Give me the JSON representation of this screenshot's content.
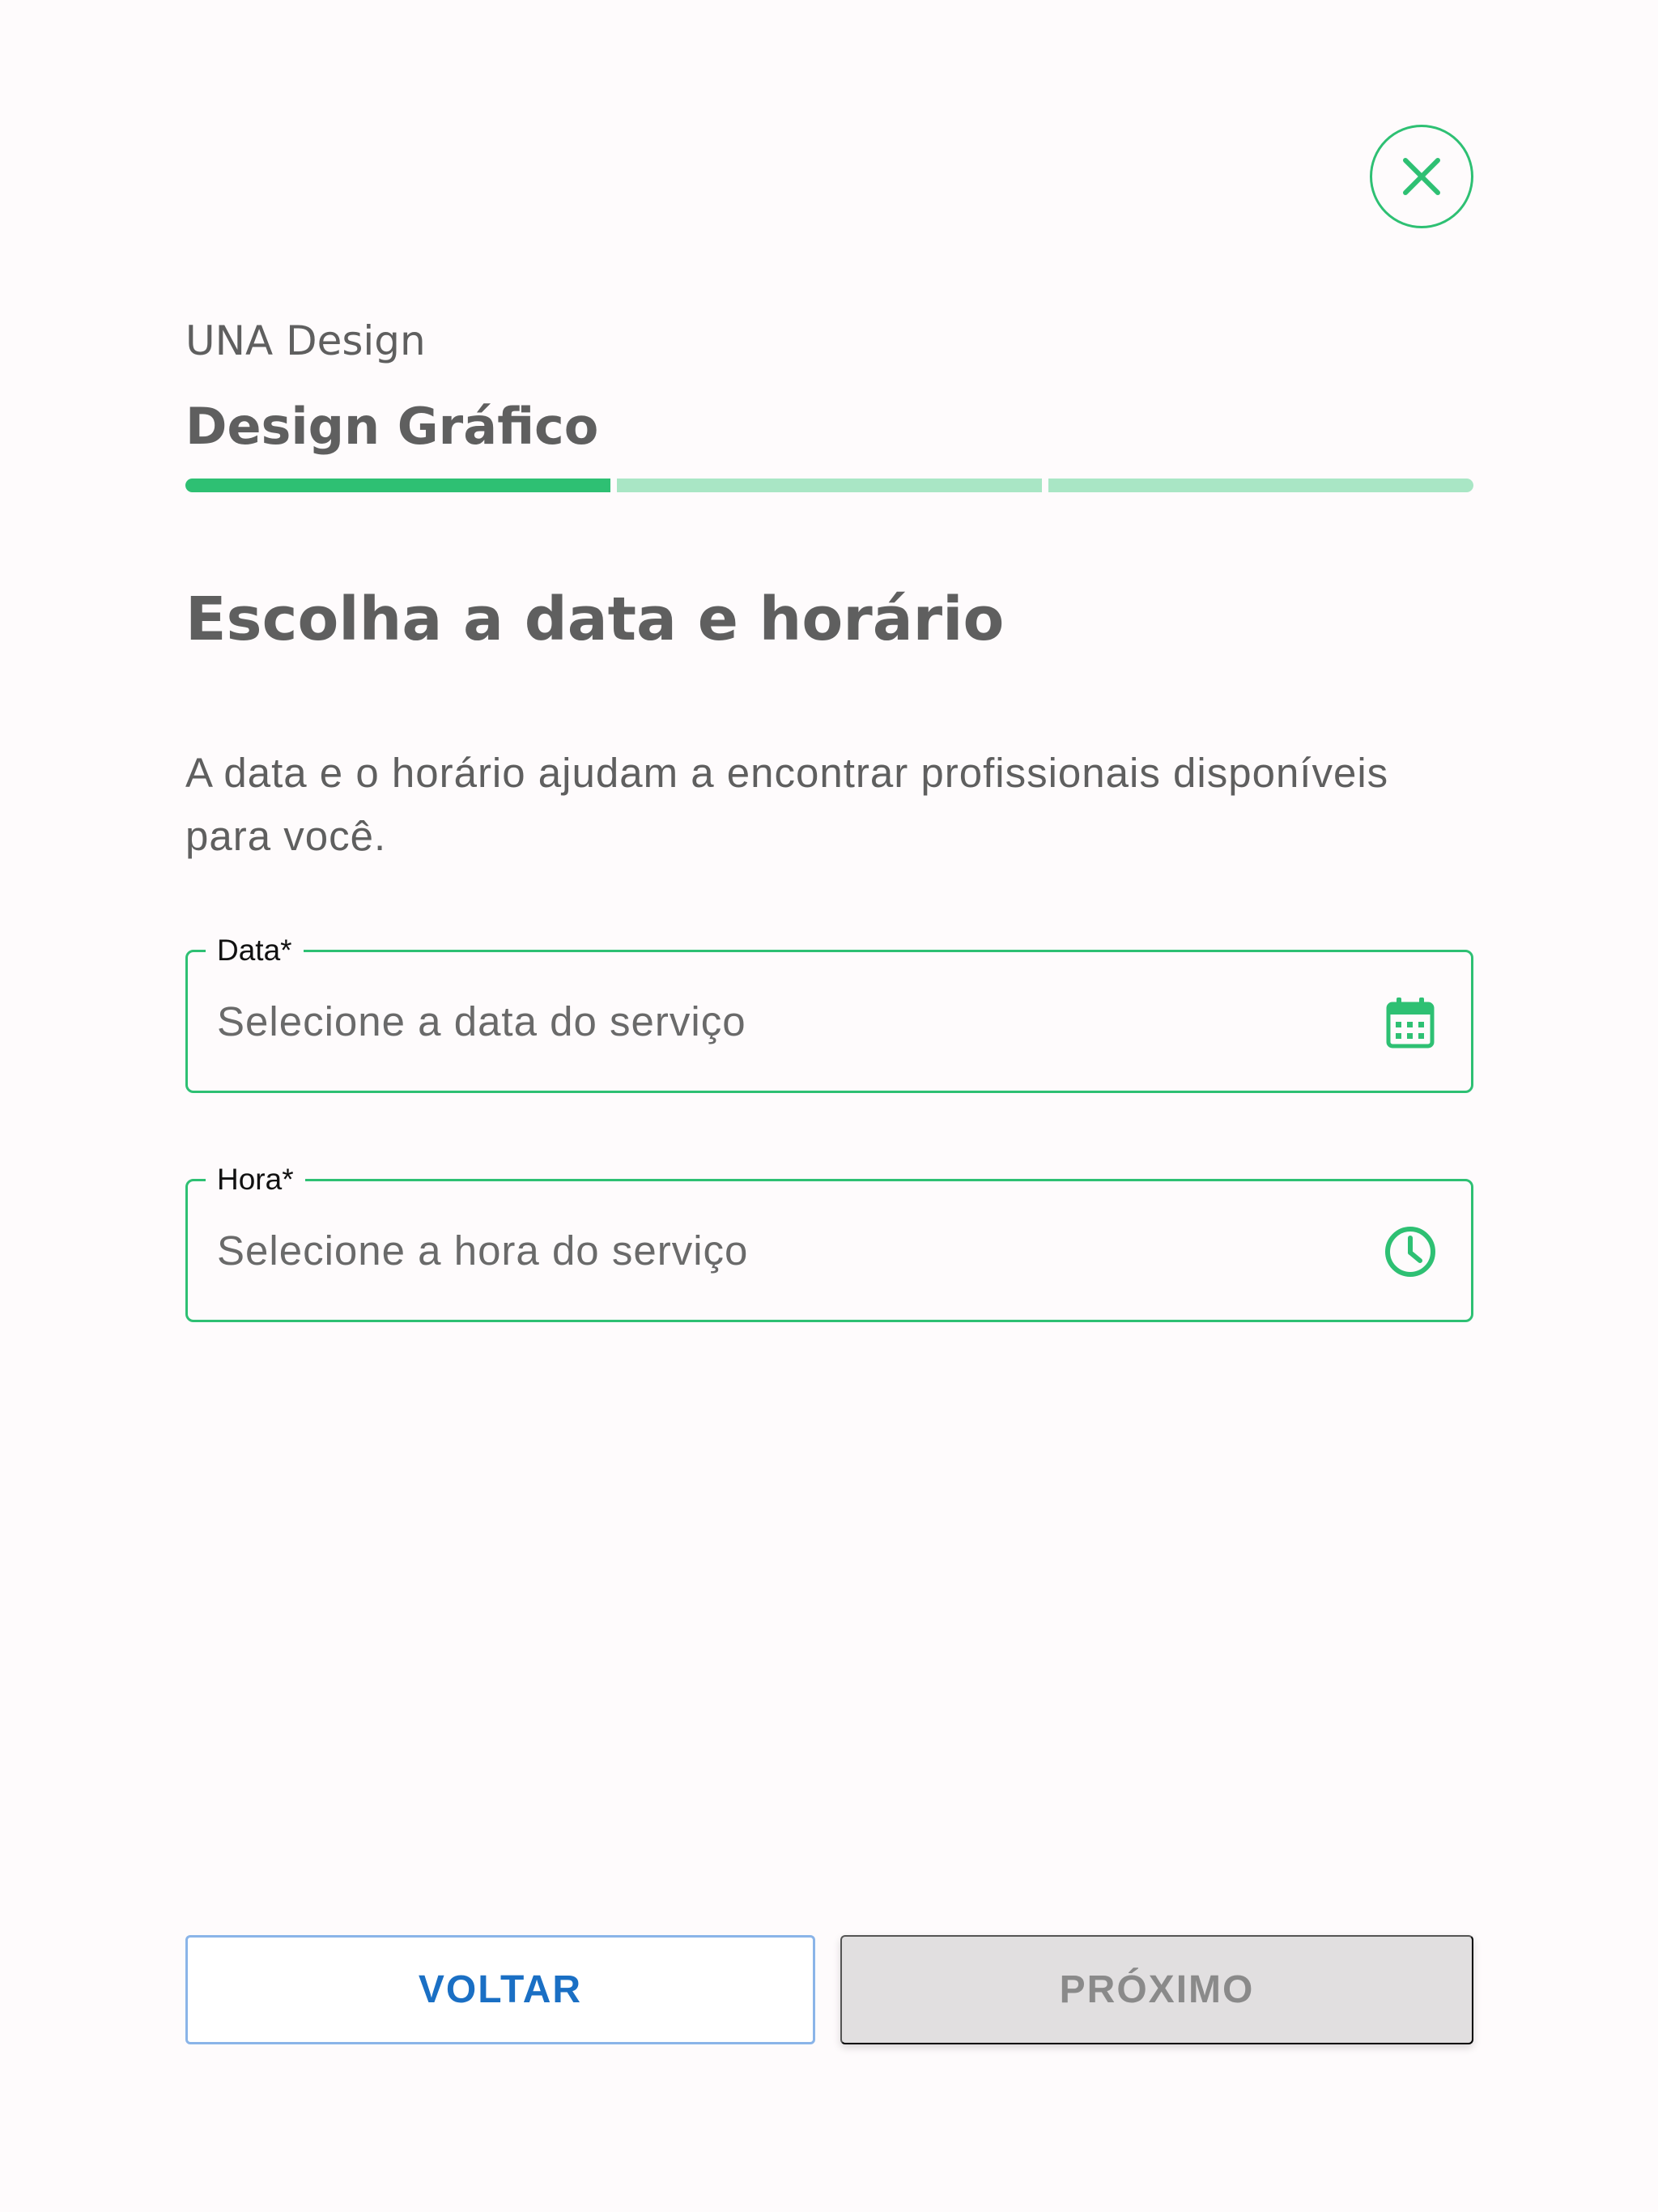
{
  "header": {
    "provider": "UNA Design",
    "service": "Design Gráfico"
  },
  "progress": {
    "current_step": 1,
    "total_steps": 3
  },
  "main": {
    "heading": "Escolha a data e horário",
    "description": "A data e o horário ajudam a encontrar profissionais disponíveis para você."
  },
  "fields": {
    "date": {
      "label": "Data*",
      "placeholder": "Selecione a data do serviço",
      "icon": "calendar-icon"
    },
    "time": {
      "label": "Hora*",
      "placeholder": "Selecione a hora do serviço",
      "icon": "clock-icon"
    }
  },
  "buttons": {
    "back": "VOLTAR",
    "next": "PRÓXIMO"
  },
  "colors": {
    "accent": "#2EC073",
    "accent_light": "#A9E6C5",
    "link_blue": "#1A6FC4",
    "disabled_bg": "#E1DFE0"
  }
}
